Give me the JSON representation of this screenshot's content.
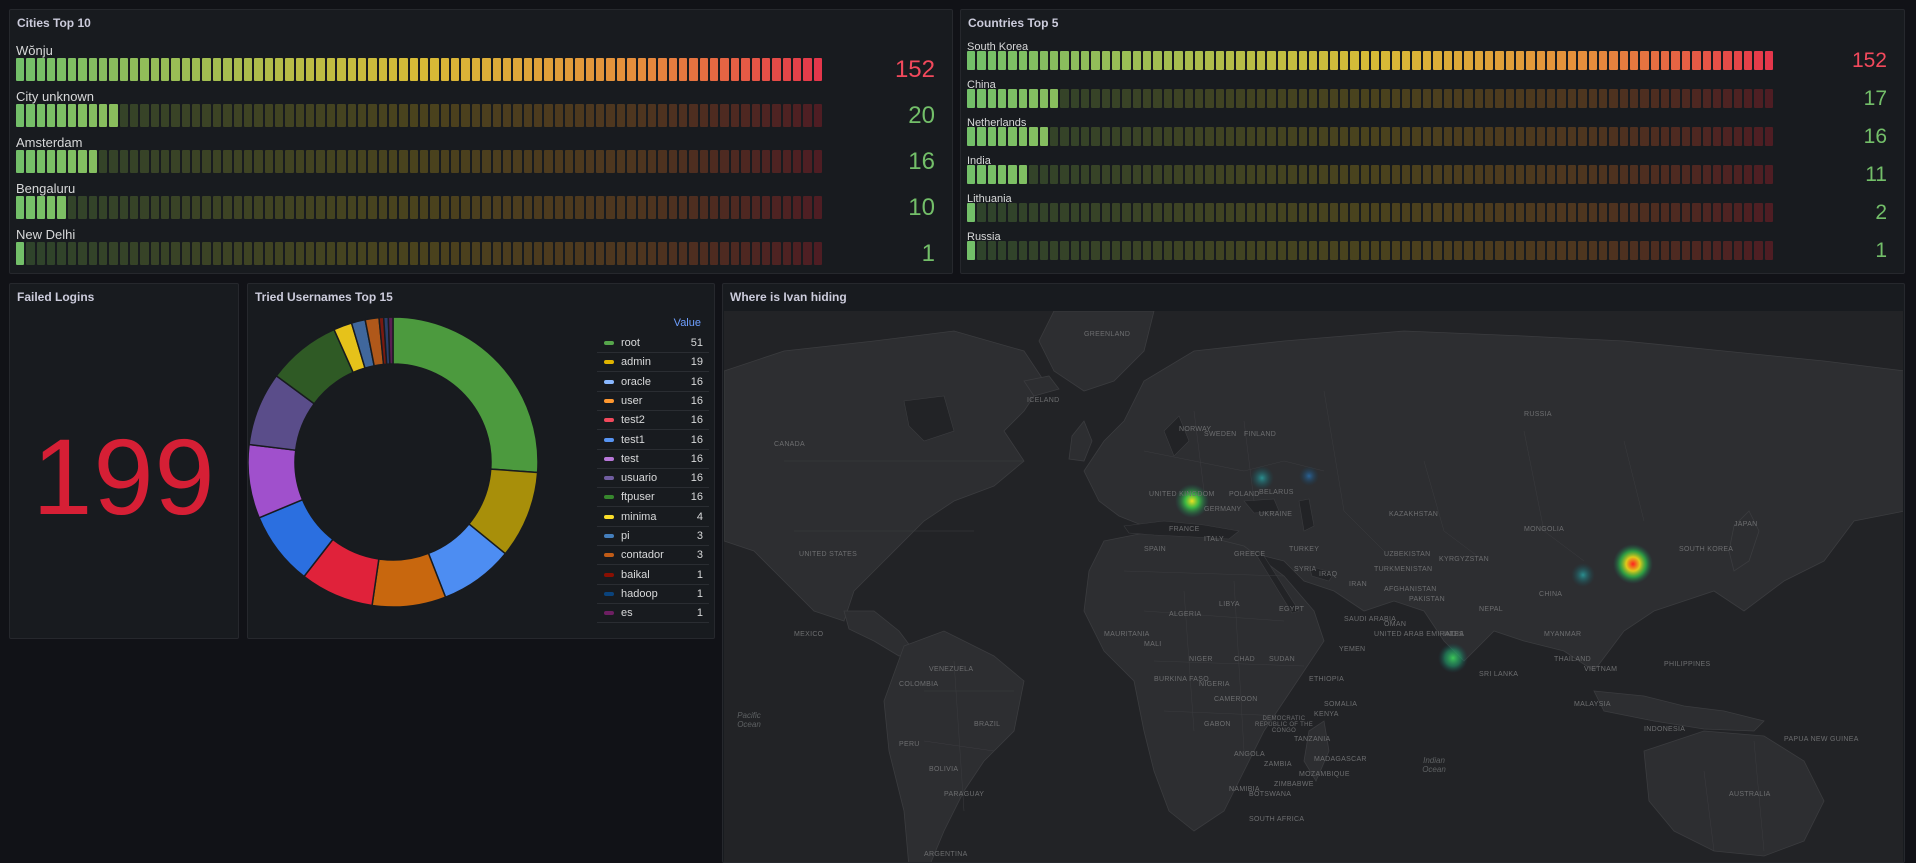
{
  "cities_panel": {
    "title": "Cities Top 10",
    "max": 152,
    "items": [
      {
        "label": "Wŏnju",
        "value": 152,
        "value_color": "#f2495c"
      },
      {
        "label": "City unknown",
        "value": 20,
        "value_color": "#73bf69"
      },
      {
        "label": "Amsterdam",
        "value": 16,
        "value_color": "#73bf69"
      },
      {
        "label": "Bengaluru",
        "value": 10,
        "value_color": "#73bf69"
      },
      {
        "label": "New Delhi",
        "value": 1,
        "value_color": "#73bf69"
      }
    ]
  },
  "countries_panel": {
    "title": "Countries Top 5",
    "max": 152,
    "items": [
      {
        "label": "South Korea",
        "value": 152,
        "value_color": "#f2495c"
      },
      {
        "label": "China",
        "value": 17,
        "value_color": "#73bf69"
      },
      {
        "label": "Netherlands",
        "value": 16,
        "value_color": "#73bf69"
      },
      {
        "label": "India",
        "value": 11,
        "value_color": "#73bf69"
      },
      {
        "label": "Lithuania",
        "value": 2,
        "value_color": "#73bf69"
      },
      {
        "label": "Russia",
        "value": 1,
        "value_color": "#73bf69"
      }
    ]
  },
  "failed_logins": {
    "title": "Failed Logins",
    "value": "199",
    "color": "#d61f35"
  },
  "usernames_panel": {
    "title": "Tried Usernames Top 15",
    "legend_header": "Value",
    "chart_data": {
      "type": "pie",
      "donut": true,
      "categories": [
        "root",
        "admin",
        "oracle",
        "user",
        "test2",
        "test1",
        "test",
        "usuario",
        "ftpuser",
        "minima",
        "pi",
        "contador",
        "baikal",
        "hadoop",
        "es"
      ],
      "values": [
        51,
        19,
        16,
        16,
        16,
        16,
        16,
        16,
        16,
        4,
        3,
        3,
        1,
        1,
        1
      ],
      "colors": [
        "#56a64b",
        "#e0b400",
        "#8ab8ff",
        "#ff9830",
        "#f2495c",
        "#5794f2",
        "#b877d9",
        "#705da0",
        "#37872d",
        "#fade2a",
        "#447ebc",
        "#c15c17",
        "#890f02",
        "#0a437c",
        "#6d1f62"
      ],
      "slice_colors": [
        "#4c9a3e",
        "#a88f0a",
        "#4d8df2",
        "#c8670e",
        "#e0223a",
        "#2b6fe0",
        "#a050cc",
        "#5a4d8a",
        "#2f5a25",
        "#e6c21a",
        "#40679c",
        "#b0581a",
        "#7a1a10",
        "#2a3f6a",
        "#5a1e52"
      ]
    }
  },
  "map_panel": {
    "title": "Where is Ivan hiding",
    "region_labels": [
      "RUSSIA",
      "CANADA",
      "UNITED STATES",
      "MEXICO",
      "GREENLAND",
      "ICELAND",
      "FRANCE",
      "SPAIN",
      "POLAND",
      "UKRAINE",
      "BELARUS",
      "TURKEY",
      "IRAN",
      "IRAQ",
      "KAZAKHSTAN",
      "MONGOLIA",
      "CHINA",
      "INDIA",
      "PAKISTAN",
      "AFGHANISTAN",
      "SAUDI ARABIA",
      "EGYPT",
      "LIBYA",
      "ALGERIA",
      "MALI",
      "NIGER",
      "CHAD",
      "SUDAN",
      "ETHIOPIA",
      "NIGERIA",
      "KENYA",
      "DEMOCRATIC REPUBLIC OF THE CONGO",
      "TANZANIA",
      "ANGOLA",
      "ZAMBIA",
      "NAMIBIA",
      "SOUTH AFRICA",
      "MADAGASCAR",
      "BRAZIL",
      "PERU",
      "BOLIVIA",
      "COLOMBIA",
      "VENEZUELA",
      "PARAGUAY",
      "ARGENTINA",
      "AUSTRALIA",
      "INDONESIA",
      "PHILIPPINES",
      "JAPAN",
      "SOUTH KOREA",
      "MYANMAR",
      "THAILAND",
      "VIETNAM",
      "MAURITANIA",
      "BURKINA FASO",
      "SOMALIA",
      "YEMEN",
      "OMAN",
      "KYRGYZSTAN",
      "UZBEKISTAN",
      "TURKMENISTAN",
      "UNITED ARAB EMIRATES",
      "PAPUA NEW GUINEA",
      "MOZAMBIQUE",
      "BOTSWANA",
      "ZIMBABWE",
      "CAMEROON",
      "GABON",
      "NEPAL",
      "SRI LANKA",
      "MALAYSIA",
      "FINLAND",
      "SWEDEN",
      "NORWAY",
      "GERMANY",
      "ITALY",
      "GREECE",
      "SYRIA",
      "UNITED KINGDOM"
    ],
    "ocean_labels": [
      "Pacific Ocean",
      "Indian Ocean"
    ],
    "hotspots": [
      "Amsterdam",
      "Lithuania",
      "Russia",
      "South Korea",
      "China",
      "India"
    ]
  }
}
